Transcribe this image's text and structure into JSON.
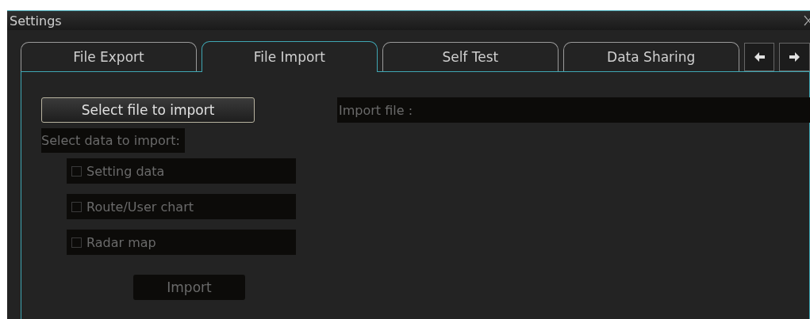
{
  "window": {
    "title": "Settings"
  },
  "tabs": [
    {
      "label": "File Export",
      "selected": false
    },
    {
      "label": "File Import",
      "selected": true
    },
    {
      "label": "Self Test",
      "selected": false
    },
    {
      "label": "Data Sharing",
      "selected": false
    }
  ],
  "select_file_button": {
    "label": "Select file to import"
  },
  "import_file": {
    "label": "Import file :",
    "disabled": true
  },
  "select_data": {
    "label": "Select data to import:",
    "disabled": true
  },
  "options": [
    {
      "label": "Setting data",
      "checked": false,
      "disabled": true
    },
    {
      "label": "Route/User chart",
      "checked": false,
      "disabled": true
    },
    {
      "label": "Radar map",
      "checked": false,
      "disabled": true
    }
  ],
  "import_button": {
    "label": "Import",
    "disabled": true
  }
}
